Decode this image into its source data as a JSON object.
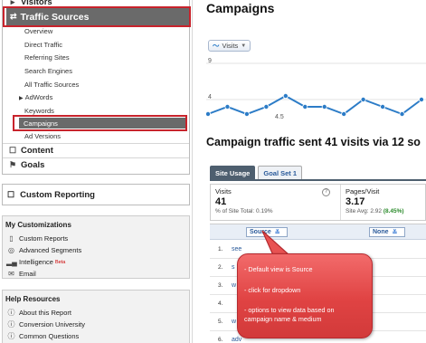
{
  "sidebar": {
    "nav": {
      "visitors": "Visitors",
      "traffic_sources": "Traffic Sources",
      "sub_items": [
        "Overview",
        "Direct Traffic",
        "Referring Sites",
        "Search Engines",
        "All Traffic Sources",
        "AdWords",
        "Keywords",
        "Campaigns",
        "Ad Versions"
      ],
      "content": "Content",
      "goals": "Goals"
    },
    "custom_reporting": "Custom Reporting",
    "my_customizations": {
      "title": "My Customizations",
      "items": [
        "Custom Reports",
        "Advanced Segments",
        "Intelligence",
        "Email"
      ],
      "beta": "Beta"
    },
    "help_resources": {
      "title": "Help Resources",
      "items": [
        "About this Report",
        "Conversion University",
        "Common Questions"
      ]
    }
  },
  "main": {
    "title": "Campaigns",
    "chart": {
      "metric_label": "Visits",
      "y_max_label": "9",
      "y_mid_label": "4",
      "point_label": "4.5"
    },
    "section_title": "Campaign traffic sent 41 visits via 12 so",
    "tabs": [
      "Site Usage",
      "Goal Set 1"
    ],
    "metrics": {
      "visits_label": "Visits",
      "visits_value": "41",
      "visits_sub": "% of Site Total: 0.19%",
      "pages_label": "Pages/Visit",
      "pages_value": "3.17",
      "pages_sub_prefix": "Site Avg: 2.92",
      "pages_sub_delta": "(8.45%)",
      "help": "?"
    },
    "table": {
      "primary_dimension": "Source",
      "secondary_dimension": "None",
      "rows": [
        {
          "idx": "1.",
          "value": "see"
        },
        {
          "idx": "2.",
          "value": "s"
        },
        {
          "idx": "3.",
          "value": "w"
        },
        {
          "idx": "4.",
          "value": ""
        },
        {
          "idx": "5.",
          "value": "w"
        },
        {
          "idx": "6.",
          "value": "adv"
        }
      ]
    }
  },
  "callout": {
    "line1": "- Default view is Source",
    "line2": "- click for dropdown",
    "line3a": "- options to view data based   on",
    "line3b": "campaign name & medium"
  },
  "chart_data": {
    "type": "line",
    "y_ticks": [
      9,
      4
    ],
    "values": [
      2,
      3,
      2,
      3,
      4.5,
      3,
      3,
      2,
      4,
      3,
      2,
      4
    ]
  },
  "colors": {
    "active_nav": "#6a6a6a",
    "highlight_box": "#c8232c",
    "chart_line": "#2c7cc7",
    "callout": "#e04343"
  }
}
